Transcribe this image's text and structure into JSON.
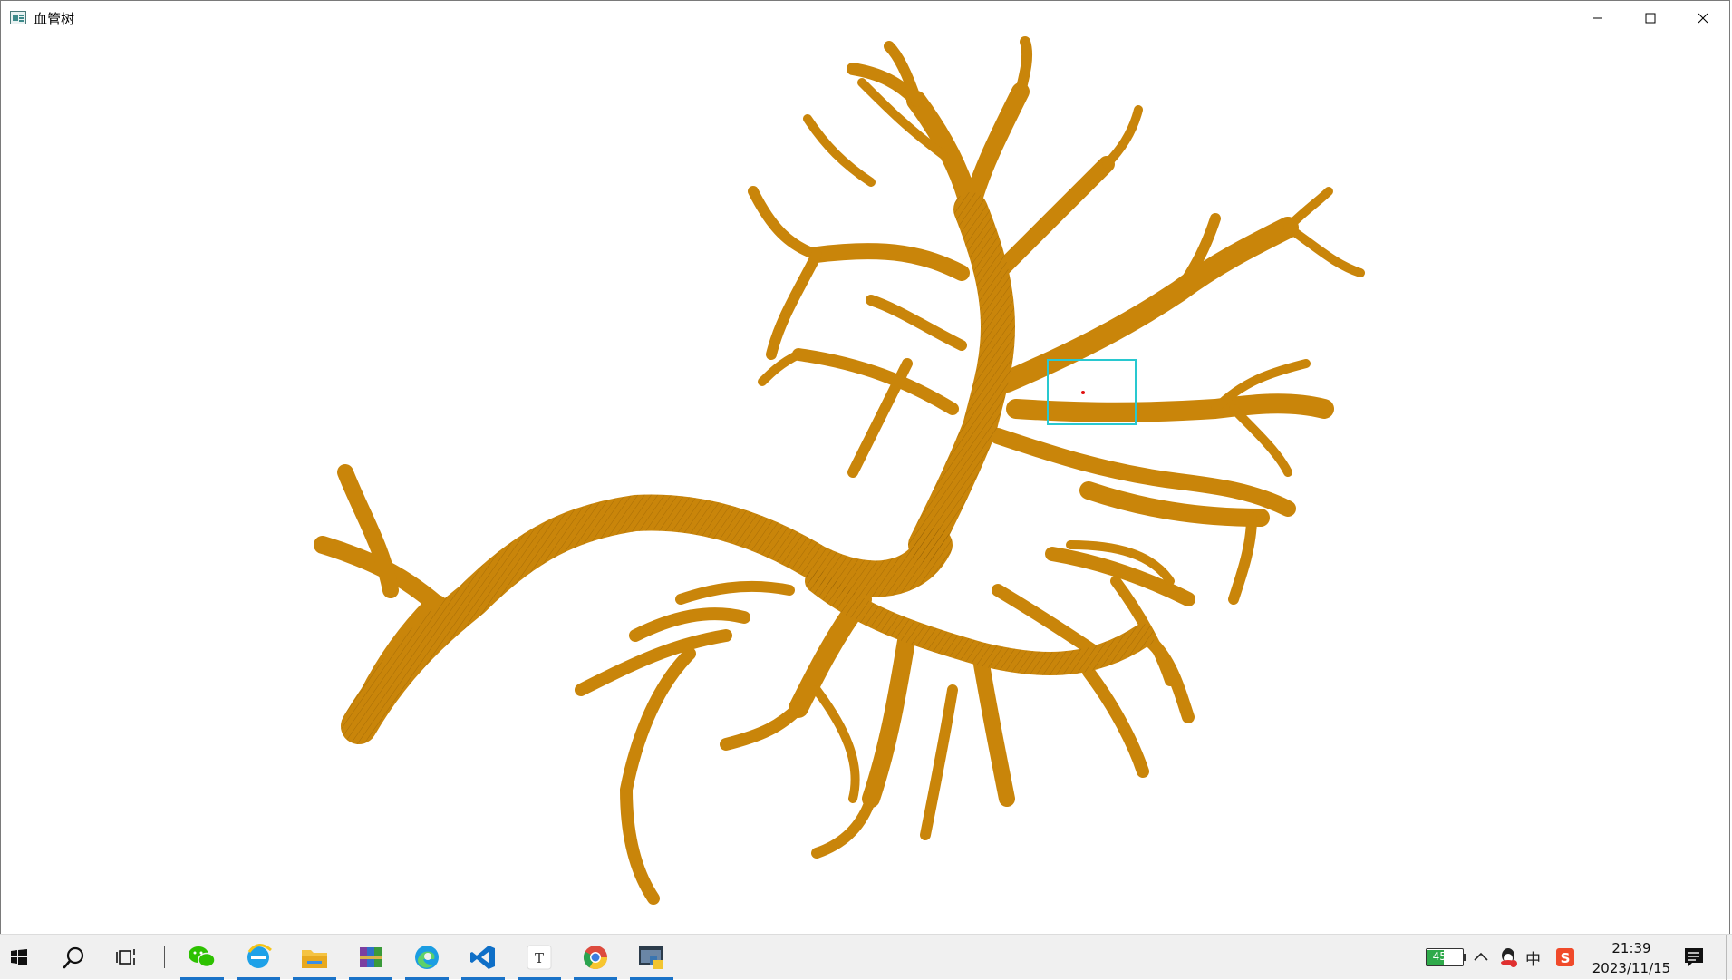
{
  "window": {
    "title": "血管树",
    "icon": "app-window-icon",
    "controls": [
      "minimize-icon",
      "maximize-icon",
      "close-icon"
    ]
  },
  "viewport": {
    "model": "vessel-tree-3d-render",
    "model_color": "#d08a0a",
    "selection_box_color": "#28c8d0",
    "selection_marker_color": "#e01010"
  },
  "taskbar": {
    "apps": [
      {
        "name": "start-icon",
        "active": false
      },
      {
        "name": "search-icon",
        "active": false
      },
      {
        "name": "task-view-icon",
        "active": false
      },
      {
        "name": "wechat-icon",
        "active": true
      },
      {
        "name": "ie-icon",
        "active": true
      },
      {
        "name": "file-explorer-icon",
        "active": true
      },
      {
        "name": "winrar-icon",
        "active": true
      },
      {
        "name": "edge-icon",
        "active": true
      },
      {
        "name": "vscode-icon",
        "active": true
      },
      {
        "name": "typora-icon",
        "active": true
      },
      {
        "name": "chrome-icon",
        "active": true
      },
      {
        "name": "python-app-icon",
        "active": true
      }
    ],
    "tray": {
      "battery_percent": "45%",
      "battery_level": 0.45,
      "ime": "中",
      "time": "21:39",
      "date": "2023/11/15"
    }
  }
}
